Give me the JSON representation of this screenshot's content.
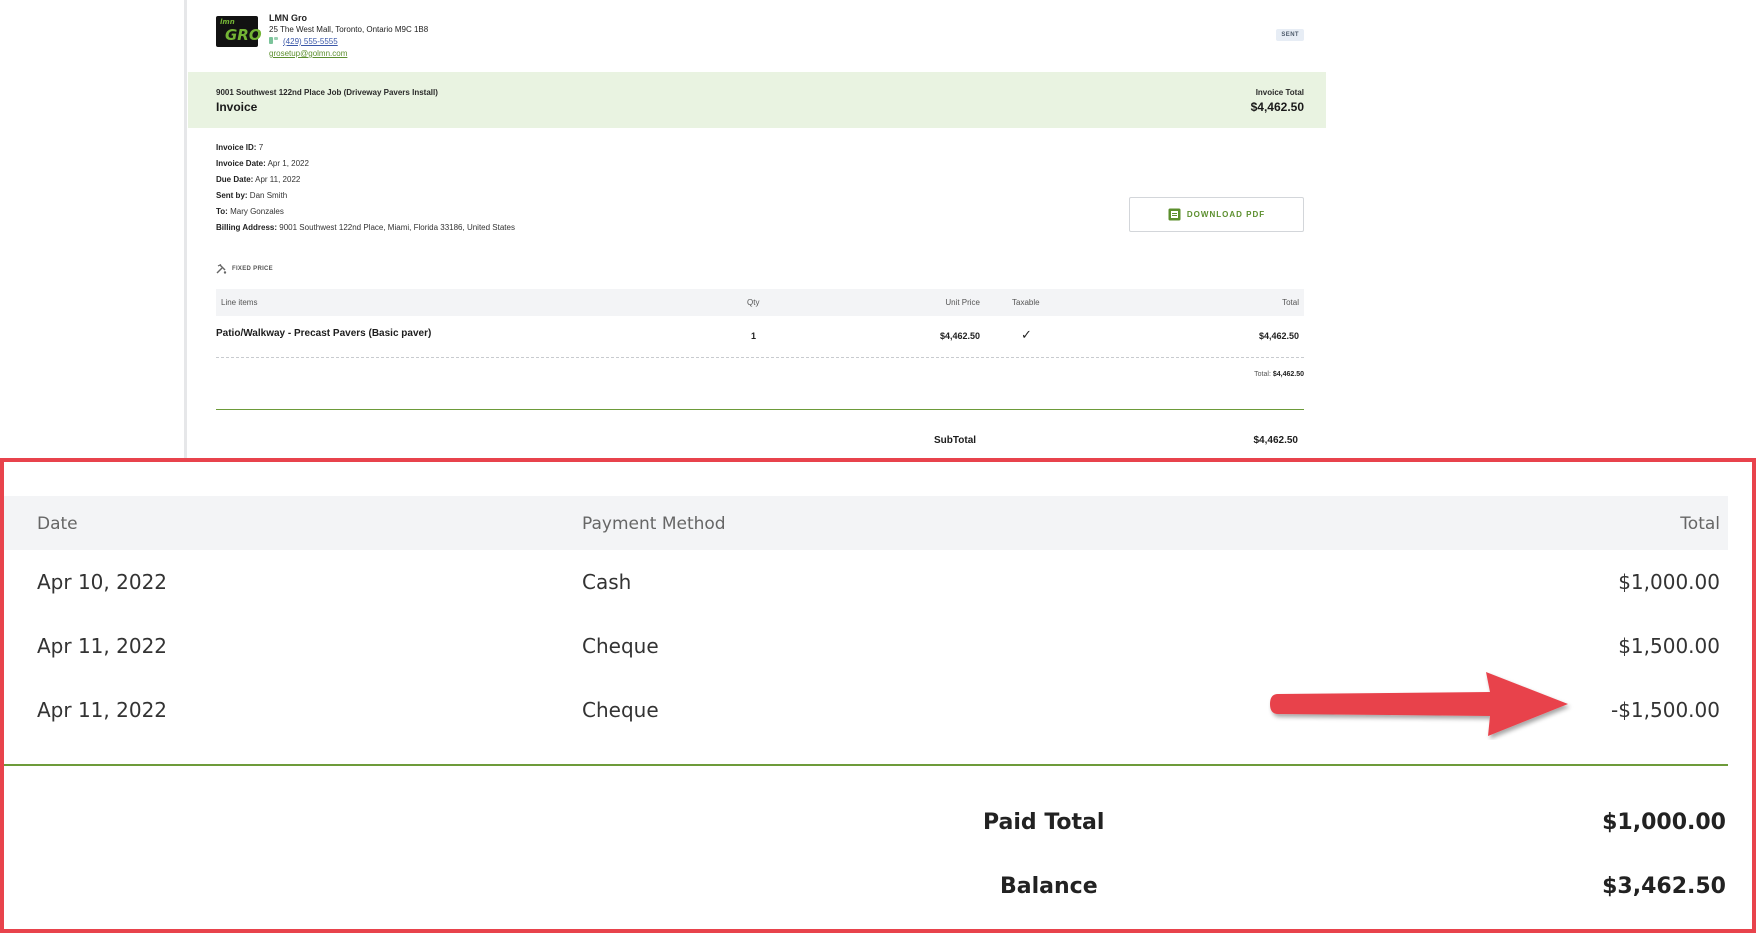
{
  "company": {
    "logo_text_small": "lmn",
    "logo_text_large": "GRO",
    "name": "LMN Gro",
    "address": "25 The West Mall, Toronto, Ontario M9C 1B8",
    "phone": "(429) 555-5555",
    "email": "grosetup@golmn.com"
  },
  "status_badge": "SENT",
  "banner": {
    "job": "9001 Southwest 122nd Place Job (Driveway Pavers Install)",
    "title": "Invoice",
    "total_label": "Invoice Total",
    "total_value": "$4,462.50"
  },
  "details": [
    {
      "label": "Invoice ID:",
      "value": "7"
    },
    {
      "label": "Invoice Date:",
      "value": "Apr 1, 2022"
    },
    {
      "label": "Due Date:",
      "value": "Apr 11, 2022"
    },
    {
      "label": "Sent by:",
      "value": "Dan Smith"
    },
    {
      "label": "To:",
      "value": "Mary Gonzales"
    },
    {
      "label": "Billing Address:",
      "value": "9001 Southwest 122nd Place, Miami, Florida 33186, United States"
    }
  ],
  "download_label": "DOWNLOAD PDF",
  "pricing_label": "FIXED PRICE",
  "line_items": {
    "headers": {
      "item": "Line items",
      "qty": "Qty",
      "unit": "Unit Price",
      "taxable": "Taxable",
      "total": "Total"
    },
    "rows": [
      {
        "item": "Patio/Walkway - Precast Pavers (Basic paver)",
        "qty": "1",
        "unit": "$4,462.50",
        "taxable": "✓",
        "total": "$4,462.50"
      }
    ],
    "total_label": "Total:",
    "total_value": "$4,462.50"
  },
  "subtotal": {
    "label": "SubTotal",
    "value": "$4,462.50"
  },
  "payments": {
    "headers": {
      "date": "Date",
      "method": "Payment Method",
      "total": "Total"
    },
    "rows": [
      {
        "date": "Apr 10, 2022",
        "method": "Cash",
        "amount": "$1,000.00"
      },
      {
        "date": "Apr 11, 2022",
        "method": "Cheque",
        "amount": "$1,500.00"
      },
      {
        "date": "Apr 11, 2022",
        "method": "Cheque",
        "amount": "-$1,500.00"
      }
    ]
  },
  "summary": {
    "paid_label": "Paid Total",
    "paid_value": "$1,000.00",
    "balance_label": "Balance",
    "balance_value": "$3,462.50"
  },
  "colors": {
    "accent_green": "#5c8f2e",
    "banner_bg": "#e9f3e1",
    "highlight_red": "#e8434c"
  }
}
